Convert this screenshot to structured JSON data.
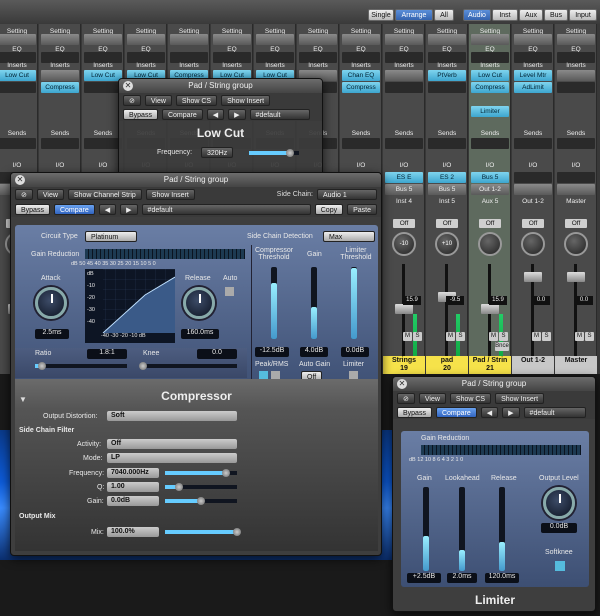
{
  "topbar": {
    "buttons": [
      {
        "label": "Single",
        "on": false
      },
      {
        "label": "Arrange",
        "on": true
      },
      {
        "label": "All",
        "on": false
      },
      {
        "label": "Audio",
        "on": true
      },
      {
        "label": "Inst",
        "on": false
      },
      {
        "label": "Aux",
        "on": false
      },
      {
        "label": "Bus",
        "on": false
      },
      {
        "label": "Input",
        "on": false
      }
    ]
  },
  "mixer": {
    "strips": [
      {
        "setting": "Setting",
        "eq": "EQ",
        "inserts": "Inserts",
        "ins1": "Low Cut",
        "ins2": "",
        "sends": "Sends",
        "io": "I/O",
        "name": ""
      },
      {
        "setting": "Setting",
        "eq": "EQ",
        "inserts": "Inserts",
        "ins1": "",
        "ins2": "Compress",
        "sends": "Sends",
        "io": "I/O",
        "name": ""
      },
      {
        "setting": "Setting",
        "eq": "EQ",
        "inserts": "Inserts",
        "ins1": "Low Cut",
        "ins2": "",
        "sends": "Sends",
        "io": "I/O",
        "name": ""
      },
      {
        "setting": "Setting",
        "eq": "EQ",
        "inserts": "Inserts",
        "ins1": "Low Cut",
        "ins2": "",
        "sends": "Sends",
        "io": "I/O",
        "name": ""
      },
      {
        "setting": "Setting",
        "eq": "",
        "inserts": "Inserts",
        "ins1": "Compress",
        "ins2": "",
        "sends": "Sends",
        "io": "I/O",
        "name": ""
      },
      {
        "setting": "Setting",
        "eq": "EQ",
        "inserts": "Inserts",
        "ins1": "Low Cut",
        "ins2": "",
        "sends": "Sends",
        "io": "I/O",
        "name": ""
      },
      {
        "setting": "Setting",
        "eq": "EQ",
        "inserts": "Inserts",
        "ins1": "Low Cut",
        "ins2": "",
        "sends": "Sends",
        "io": "I/O",
        "name": ""
      },
      {
        "setting": "Setting",
        "eq": "EQ",
        "inserts": "Inserts",
        "ins1": "",
        "ins2": "",
        "sends": "Sends",
        "io": "I/O",
        "name": ""
      },
      {
        "setting": "Setting",
        "eq": "EQ",
        "inserts": "Inserts",
        "ins1": "Chan EQ",
        "ins2": "Compress",
        "sends": "Sends",
        "io": "I/O",
        "name": ""
      },
      {
        "setting": "Setting",
        "eq": "EQ",
        "inserts": "Inserts",
        "ins1": "",
        "ins2": "",
        "sends": "Sends",
        "io": "I/O",
        "sendval": "ES E",
        "bus": "Bus 5",
        "out": "Inst 4",
        "pan": "-10",
        "fader": "15.9",
        "name": "Strings",
        "num": "19"
      },
      {
        "setting": "Setting",
        "eq": "EQ",
        "inserts": "Inserts",
        "ins1": "PtVerb",
        "ins2": "",
        "sends": "Sends",
        "io": "I/O",
        "sendval": "ES 2",
        "bus": "Bus 5",
        "out": "Inst 5",
        "pan": "+10",
        "fader": "-9.5",
        "name": "pad",
        "num": "20"
      },
      {
        "setting": "Setting",
        "eq": "EQ",
        "inserts": "Inserts",
        "ins1": "Low Cut",
        "ins2": "Compress",
        "sends": "Sends",
        "io": "I/O",
        "sendval": "Bus 5",
        "bus": "Out 1-2",
        "out": "Aux 5",
        "pan": "",
        "fader": "15.9",
        "name": "Pad / Strin",
        "num": "21"
      },
      {
        "setting": "Setting",
        "eq": "EQ",
        "inserts": "Inserts",
        "ins1": "Level Mtr",
        "ins2": "AdLimit",
        "sends": "Sends",
        "io": "I/O",
        "sendval": "",
        "bus": "",
        "out": "Out 1-2",
        "pan": "",
        "fader": "0.0",
        "name": "Out 1-2",
        "num": ""
      },
      {
        "setting": "Setting",
        "eq": "EQ",
        "inserts": "Inserts",
        "ins1": "",
        "ins2": "",
        "sends": "Sends",
        "io": "I/O",
        "sendval": "",
        "bus": "",
        "out": "Master",
        "pan": "",
        "fader": "0.0",
        "name": "Master",
        "num": ""
      }
    ],
    "bnce": "Bnce",
    "mute": "M",
    "solo": "S",
    "off": "Off",
    "ins3": "Limiter"
  },
  "lowcut": {
    "title": "Pad / String group",
    "view": "View",
    "show": "Show CS",
    "insert": "Show Insert",
    "bypass": "Bypass",
    "compare": "Compare",
    "preset": "#default",
    "name": "Low Cut",
    "freq_label": "Frequency:",
    "freq": "320Hz",
    "frac": 0.82
  },
  "comp": {
    "title": "Pad / String group",
    "view": "View",
    "show": "Show Channel Strip",
    "insert": "Show Insert",
    "sidechain_label": "Side Chain:",
    "sidechain": "Audio 1",
    "bypass": "Bypass",
    "compare": "Compare",
    "preset": "#default",
    "copy": "Copy",
    "paste": "Paste",
    "circuit_label": "Circuit Type",
    "circuit": "Platinum",
    "scd_label": "Side Chain Detection",
    "scd": "Max",
    "gr_label": "Gain Reduction",
    "gr_scale": "dB 50 45 40 35 30 25 20 15 10 5 0",
    "attack_label": "Attack",
    "attack": "2.5ms",
    "release_label": "Release",
    "release": "160.0ms",
    "auto": "Auto",
    "graph_db": [
      "dB",
      "-10",
      "-20",
      "-30",
      "-40"
    ],
    "graph_x": "-40 -30 -20 -10 dB",
    "ratio_label": "Ratio",
    "ratio": "1.8:1",
    "ratio_frac": 0.08,
    "knee_label": "Knee",
    "knee": "0.0",
    "knee_frac": 0.0,
    "thresh_label": "Compressor Threshold",
    "thresh": "-12.5dB",
    "thresh_frac": 0.78,
    "gain_label": "Gain",
    "gain": "4.0dB",
    "gain_frac": 0.45,
    "lthresh_label": "Limiter Threshold",
    "lthresh": "0.0dB",
    "lthresh_frac": 0.98,
    "peak_label": "Peak/RMS",
    "autogain_label": "Auto Gain",
    "autogain": "Off",
    "limiter_label": "Limiter",
    "name": "Compressor",
    "od_label": "Output Distortion:",
    "od": "Soft",
    "scf_label": "Side Chain Filter",
    "activity_label": "Activity:",
    "activity": "Off",
    "mode_label": "Mode:",
    "mode": "LP",
    "freq_label": "Frequency:",
    "freq": "7040.000Hz",
    "freq_frac": 0.85,
    "q_label": "Q:",
    "q": "1.00",
    "q_frac": 0.2,
    "gain2_label": "Gain:",
    "gain2": "0.0dB",
    "gain2_frac": 0.5,
    "outmix_label": "Output Mix",
    "mix_label": "Mix:",
    "mix": "100.0%",
    "mix_frac": 1.0
  },
  "limiter": {
    "title": "Pad / String group",
    "view": "View",
    "show": "Show CS",
    "insert": "Show Insert",
    "bypass": "Bypass",
    "compare": "Compare",
    "preset": "#default",
    "gr_label": "Gain Reduction",
    "gr_scale": "dB 12 10 8 6 4 3 2 1 0",
    "gain_label": "Gain",
    "gain": "+2.5dB",
    "gain_frac": 0.42,
    "look_label": "Lookahead",
    "look": "2.0ms",
    "look_frac": 0.25,
    "rel_label": "Release",
    "rel": "120.0ms",
    "rel_frac": 0.35,
    "out_label": "Output Level",
    "out": "0.0dB",
    "softknee_label": "Softknee",
    "name": "Limiter"
  },
  "colors": {
    "accent": "#3da6cf",
    "name_yellow": "#f6e24a"
  }
}
